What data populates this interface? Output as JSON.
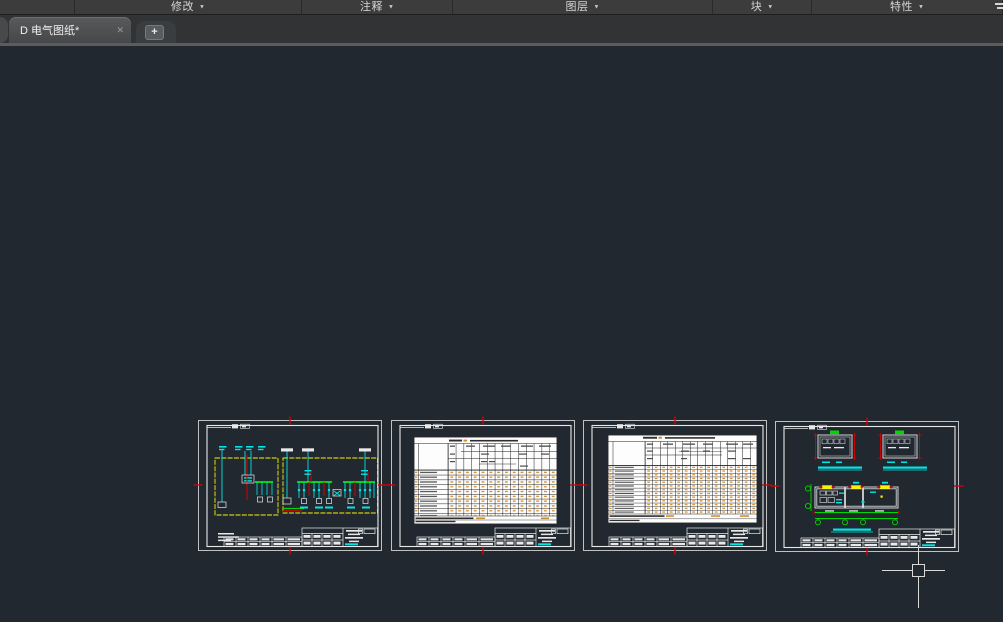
{
  "ribbon": {
    "dropdown_arrow": "▼",
    "panels": [
      {
        "id": "panel-leading",
        "label": ""
      },
      {
        "id": "panel-modify",
        "label": "修改"
      },
      {
        "id": "panel-annotate",
        "label": "注释"
      },
      {
        "id": "panel-layers",
        "label": "图层"
      },
      {
        "id": "panel-block",
        "label": "块"
      },
      {
        "id": "panel-properties",
        "label": "特性"
      }
    ]
  },
  "file_tabs": {
    "active_tab": {
      "label": "D 电气图纸*",
      "close_glyph": "✕"
    },
    "new_tab_glyph": "+"
  },
  "canvas": {
    "sheet_count": 4,
    "colors": {
      "background": "#212830",
      "frame_white": "#e8e8e8",
      "cad_yellow": "#f5f500",
      "cad_cyan": "#00e5e5",
      "cad_green": "#00d900",
      "cad_red": "#d40000",
      "table_fill": "#fdfdfd",
      "table_value_orange": "#d08a2a"
    }
  }
}
